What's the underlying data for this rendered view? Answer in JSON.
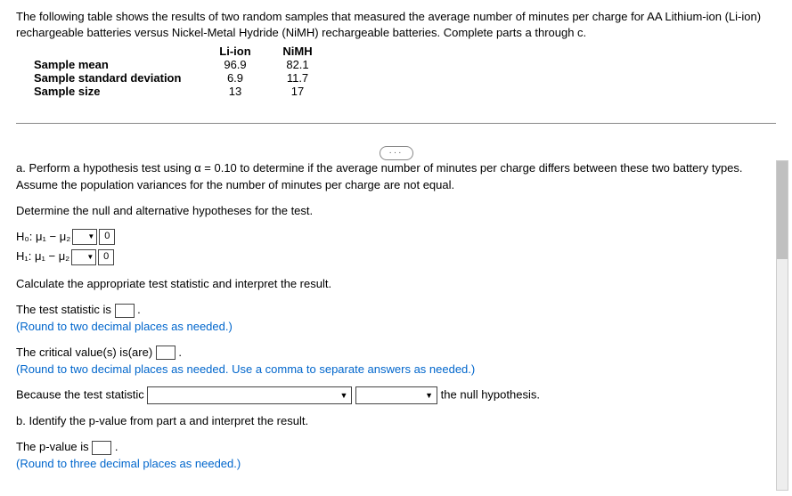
{
  "intro": "The following table shows the results of two random samples that measured the average number of minutes per charge for AA Lithium-ion (Li-ion) rechargeable batteries versus Nickel-Metal Hydride (NiMH) rechargeable batteries. Complete parts a through c.",
  "table": {
    "col1_header": "Li-ion",
    "col2_header": "NiMH",
    "rows": [
      {
        "label": "Sample mean",
        "v1": "96.9",
        "v2": "82.1"
      },
      {
        "label": "Sample standard deviation",
        "v1": "6.9",
        "v2": "11.7"
      },
      {
        "label": "Sample size",
        "v1": "13",
        "v2": "17"
      }
    ]
  },
  "ellipsis": "···",
  "partA": {
    "prompt1": "a. Perform a hypothesis test using α = 0.10 to determine if the average number of minutes per charge differs between these two battery types. Assume the population variances for the number of minutes per charge are not equal.",
    "prompt2": "Determine the null and alternative hypotheses for the test.",
    "h0_label": "H₀: μ₁ − μ₂",
    "h0_value": "0",
    "h1_label": "H₁: μ₁ − μ₂",
    "h1_value": "0",
    "calc_prompt": "Calculate the appropriate test statistic and interpret the result.",
    "test_stat_pre": "The test statistic is ",
    "test_stat_post": ".",
    "round2": "(Round to two decimal places as needed.)",
    "crit_pre": "The critical value(s) is(are) ",
    "crit_post": ".",
    "round2_comma": "(Round to two decimal places as needed. Use a comma to separate answers as needed.)",
    "because_pre": "Because the test statistic ",
    "because_post": " the null hypothesis."
  },
  "partB": {
    "prompt": "b. Identify the p-value from part a and interpret the result.",
    "pval_pre": "The p-value is ",
    "pval_post": ".",
    "round3": "(Round to three decimal places as needed.)"
  }
}
